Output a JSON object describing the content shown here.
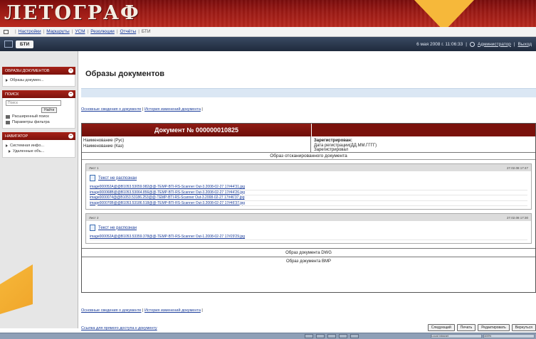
{
  "banner": {
    "logo": "ЛЕТОГРАФ"
  },
  "menubar": {
    "items": [
      "Настройки",
      "Маршруты",
      "УСМ",
      "Резолюции",
      "Отчёты"
    ],
    "current": "БТИ"
  },
  "toolbar": {
    "tab": "БТИ",
    "datetime": "6 мая 2008 г. 11:06:33",
    "user": "Администратор",
    "logout": "Выход"
  },
  "sidebar": {
    "sections": [
      {
        "title": "Образы документов",
        "items": [
          "Образы докумен..."
        ]
      },
      {
        "title": "Поиск",
        "input_placeholder": "Поиск",
        "button": "Найти",
        "items": [
          "Расширенный поиск",
          "Параметры фильтра"
        ]
      },
      {
        "title": "Навигатор",
        "items": [
          "Системная инфо...",
          "Удаленные объ..."
        ]
      }
    ]
  },
  "main": {
    "title": "Образы документов",
    "tabs": [
      "Основные сведения о документе",
      "История изменений документа"
    ],
    "document": {
      "title": "Документ № 000000010825",
      "left_fields": [
        "Наименование (Рус)",
        "Наименование (Каз)"
      ],
      "right_label": "Зарегистрирован:",
      "right_fields": [
        "Дата регистрации(ДД.ММ.ГГГГ)",
        "Зарегистрировал"
      ],
      "scan_title": "Образ отсканированного документа",
      "pages": [
        {
          "label": "Лист 1",
          "date": "27.02.08 17:47",
          "unrecognized": "Текст не распознан",
          "files": [
            "image000052A@@B1053.53059.982@@-TEMP-BTI-RS-Scanner Out-3.2008-02-27 17#44'31.jpg",
            "image000068B@@B1053.53064.856@@-TEMP-BTI-RS-Scanner Out-3.2008-02-27 17#44'26.jpg",
            "image0000074@@B1053.53186.253@@-TEMP-BTI-RS-Scanner Out-3.2008-02-27 17#46'37.jpg",
            "image000070B@@B1053.53186.518@@-TEMP-BTI-RS-Scanner Out-3.2008-02-27 17#46'37.jpg"
          ]
        },
        {
          "label": "Лист 2",
          "date": "27.02.08 17:30",
          "unrecognized": "Текст не распознан",
          "files": [
            "image000052A@@B1053.53359.378@@-TEMP-BTI-RS-Scanner Out-1.2008-02-27 17#29'29.jpg"
          ]
        }
      ],
      "extra_rows": [
        "Образ документа DWG",
        "Образ документа BMP"
      ]
    },
    "bottom_tabs": [
      "Основные сведения о документе",
      "История изменений документа"
    ],
    "access_link": "Ссылка для прямого доступа к документу",
    "actions": [
      "Следующий",
      "Печать",
      "Редактировать",
      "Вернуться"
    ]
  },
  "taskbar": {
    "tray": [
      "Local intranet",
      "100%"
    ]
  }
}
